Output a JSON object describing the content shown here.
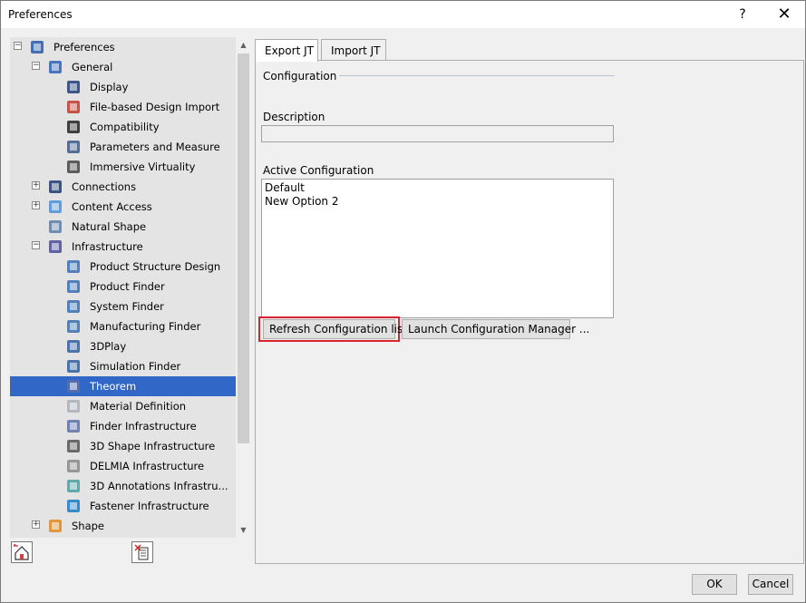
{
  "window": {
    "title": "Preferences",
    "help_glyph": "?",
    "close_glyph": "✕"
  },
  "tree": {
    "items": [
      {
        "label": "Preferences",
        "level": 0,
        "expander": "-",
        "icon": "preferences-icon"
      },
      {
        "label": "General",
        "level": 1,
        "expander": "-",
        "icon": "general-icon"
      },
      {
        "label": "Display",
        "level": 2,
        "expander": "",
        "icon": "display-icon"
      },
      {
        "label": "File-based Design Import",
        "level": 2,
        "expander": "",
        "icon": "file-import-icon"
      },
      {
        "label": "Compatibility",
        "level": 2,
        "expander": "",
        "icon": "compatibility-icon"
      },
      {
        "label": "Parameters and Measure",
        "level": 2,
        "expander": "",
        "icon": "parameters-icon"
      },
      {
        "label": "Immersive Virtuality",
        "level": 2,
        "expander": "",
        "icon": "immersive-icon"
      },
      {
        "label": "Connections",
        "level": 1,
        "expander": "+",
        "icon": "connections-icon"
      },
      {
        "label": "Content Access",
        "level": 1,
        "expander": "+",
        "icon": "content-access-icon"
      },
      {
        "label": "Natural Shape",
        "level": 1,
        "expander": "",
        "icon": "natural-shape-icon"
      },
      {
        "label": "Infrastructure",
        "level": 1,
        "expander": "-",
        "icon": "infrastructure-icon"
      },
      {
        "label": "Product Structure Design",
        "level": 2,
        "expander": "",
        "icon": "product-structure-icon"
      },
      {
        "label": "Product Finder",
        "level": 2,
        "expander": "",
        "icon": "product-finder-icon"
      },
      {
        "label": "System Finder",
        "level": 2,
        "expander": "",
        "icon": "system-finder-icon"
      },
      {
        "label": "Manufacturing Finder",
        "level": 2,
        "expander": "",
        "icon": "manufacturing-finder-icon"
      },
      {
        "label": "3DPlay",
        "level": 2,
        "expander": "",
        "icon": "3dplay-icon"
      },
      {
        "label": "Simulation Finder",
        "level": 2,
        "expander": "",
        "icon": "simulation-finder-icon"
      },
      {
        "label": "Theorem",
        "level": 2,
        "expander": "",
        "icon": "theorem-icon",
        "selected": true
      },
      {
        "label": "Material Definition",
        "level": 2,
        "expander": "",
        "icon": "material-definition-icon"
      },
      {
        "label": "Finder Infrastructure",
        "level": 2,
        "expander": "",
        "icon": "finder-infrastructure-icon"
      },
      {
        "label": "3D Shape Infrastructure",
        "level": 2,
        "expander": "",
        "icon": "3d-shape-icon"
      },
      {
        "label": "DELMIA Infrastructure",
        "level": 2,
        "expander": "",
        "icon": "delmia-icon"
      },
      {
        "label": "3D Annotations Infrastru...",
        "level": 2,
        "expander": "",
        "icon": "3d-annotations-icon"
      },
      {
        "label": "Fastener Infrastructure",
        "level": 2,
        "expander": "",
        "icon": "fastener-icon"
      },
      {
        "label": "Shape",
        "level": 1,
        "expander": "+",
        "icon": "shape-icon"
      }
    ]
  },
  "tabs": [
    {
      "label": "Export JT",
      "active": true
    },
    {
      "label": "Import JT",
      "active": false
    }
  ],
  "export_jt": {
    "configuration_title": "Configuration",
    "description_label": "Description",
    "description_value": "",
    "active_configuration_label": "Active Configuration",
    "configurations": [
      "Default",
      "New Option 2"
    ],
    "refresh_button": "Refresh Configuration list",
    "launch_button": "Launch Configuration Manager ..."
  },
  "footer": {
    "ok": "OK",
    "cancel": "Cancel"
  },
  "colors": {
    "selection": "#3168c7",
    "highlight": "#d9232e"
  }
}
